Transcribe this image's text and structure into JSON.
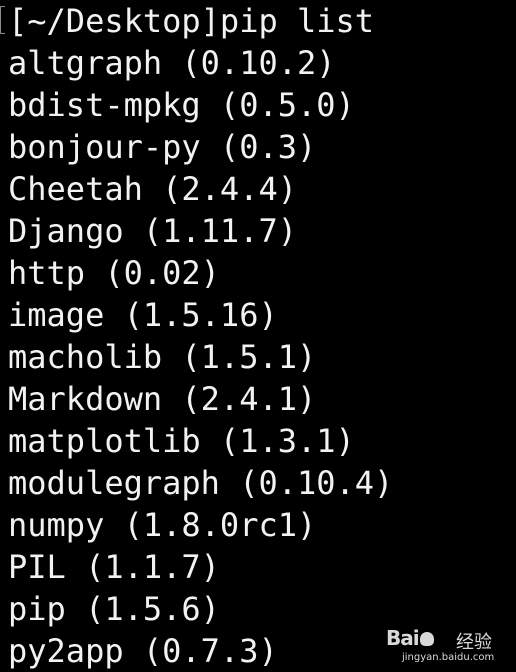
{
  "terminal": {
    "prompt_line": "[~/Desktop]pip list",
    "packages": [
      "altgraph (0.10.2)",
      "bdist-mpkg (0.5.0)",
      "bonjour-py (0.3)",
      "Cheetah (2.4.4)",
      "Django (1.11.7)",
      "http (0.02)",
      "image (1.5.16)",
      "macholib (1.5.1)",
      "Markdown (2.4.1)",
      "matplotlib (1.3.1)",
      "modulegraph (0.10.4)",
      "numpy (1.8.0rc1)",
      "PIL (1.1.7)",
      "pip (1.5.6)",
      "py2app (0.7.3)"
    ],
    "background_color": "#000000",
    "text_color": "#f2f2f2"
  },
  "watermark": {
    "logo_text_left": "Bai",
    "logo_text_right": "",
    "label": "经验",
    "site": "jingyan.baidu.com",
    "icon": "baidu-paw-icon"
  }
}
